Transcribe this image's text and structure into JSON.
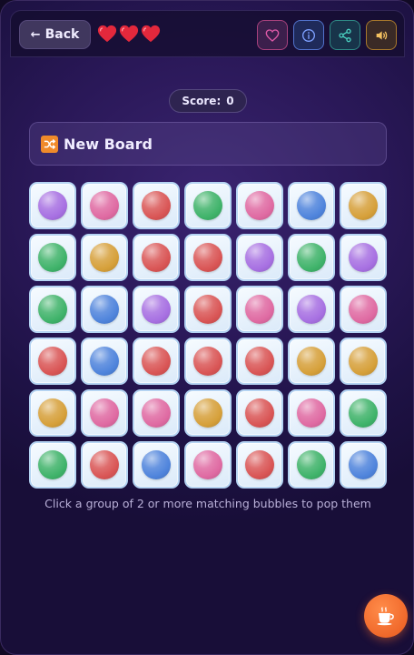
{
  "header": {
    "back_label": "Back",
    "lives": 3,
    "buttons": [
      {
        "name": "favorite",
        "icon": "heart-outline-icon",
        "color": "#e05aa8"
      },
      {
        "name": "info",
        "icon": "info-icon",
        "color": "#7ea0ff"
      },
      {
        "name": "share",
        "icon": "share-icon",
        "color": "#4ad0c0"
      },
      {
        "name": "sound",
        "icon": "speaker-icon",
        "color": "#f3c060"
      }
    ]
  },
  "score": {
    "label": "Score:",
    "value": "0"
  },
  "new_board_label": "New Board",
  "board": {
    "columns": 7,
    "rows": [
      [
        "purple",
        "pink",
        "red",
        "green",
        "pink",
        "blue",
        "orange"
      ],
      [
        "green",
        "orange",
        "red",
        "red",
        "purple",
        "green",
        "purple"
      ],
      [
        "green",
        "blue",
        "purple",
        "red",
        "pink",
        "purple",
        "pink"
      ],
      [
        "red",
        "blue",
        "red",
        "red",
        "red",
        "orange",
        "orange"
      ],
      [
        "orange",
        "pink",
        "pink",
        "orange",
        "red",
        "pink",
        "green"
      ],
      [
        "green",
        "red",
        "blue",
        "pink",
        "red",
        "green",
        "blue"
      ]
    ],
    "colors": {
      "purple": "#a770e2",
      "pink": "#df6aa2",
      "red": "#d95555",
      "green": "#3fb36a",
      "blue": "#4f84dc",
      "orange": "#d6a03a"
    }
  },
  "hint": "Click a group of 2 or more matching bubbles to pop them",
  "coffee_icon": "coffee-cup-icon"
}
